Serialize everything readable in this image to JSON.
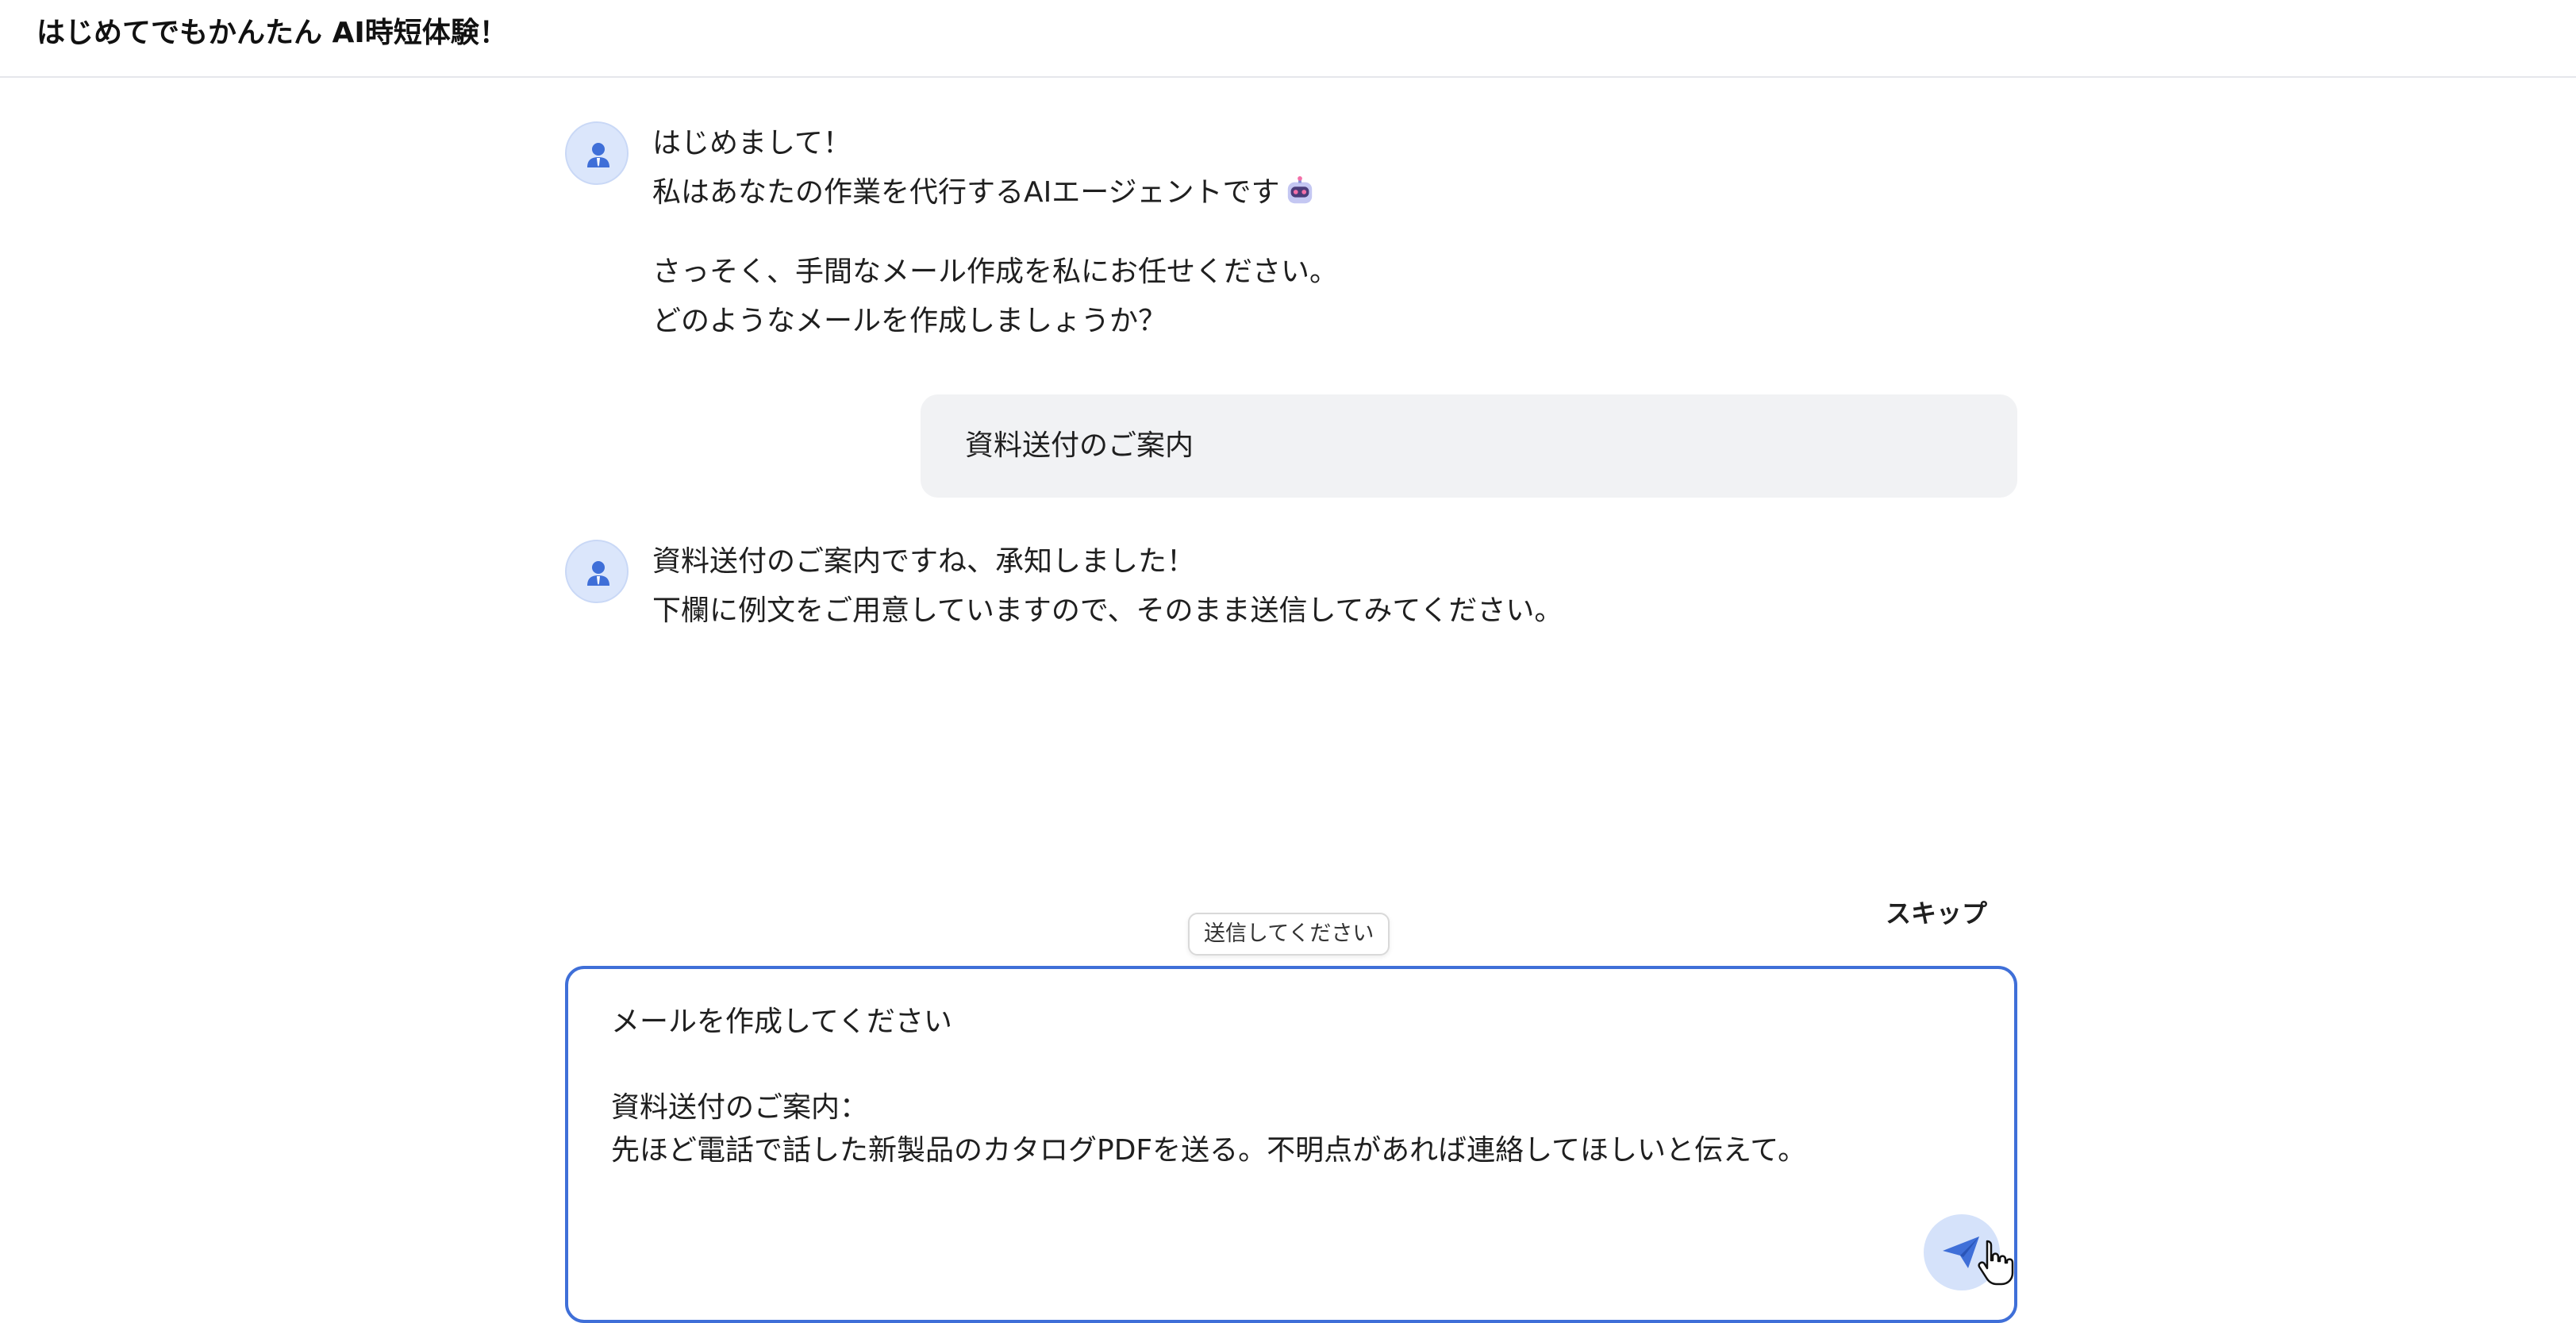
{
  "header": {
    "title": "はじめてでもかんたん AI時短体験！"
  },
  "conversation": {
    "assistant_message_1": {
      "line_1": "はじめまして！",
      "line_2": "私はあなたの作業を代行するAIエージェントです",
      "emoji_icon": "robot-face-icon",
      "line_3": "さっそく、手間なメール作成を私にお任せください。",
      "line_4": "どのようなメールを作成しましょうか？"
    },
    "user_message_1": {
      "text": "資料送付のご案内"
    },
    "assistant_message_2": {
      "line_1": "資料送付のご案内ですね、承知しました！",
      "line_2": "下欄に例文をご用意していますので、そのまま送信してみてください。"
    },
    "assistant_avatar_icon": "user-avatar-icon"
  },
  "composer": {
    "skip_label": "スキップ",
    "tooltip": "送信してください",
    "line_1": "メールを作成してください",
    "line_2": "資料送付のご案内：",
    "line_3": "先ほど電話で話した新製品のカタログPDFを送る。不明点があれば連絡してほしいと伝えて。",
    "send_icon": "paper-plane-icon"
  },
  "colors": {
    "accent": "#3f6fd8",
    "avatar_bg": "#dbe6fb",
    "bubble_bg": "#f1f2f4",
    "send_bg": "#d5e2fa"
  }
}
